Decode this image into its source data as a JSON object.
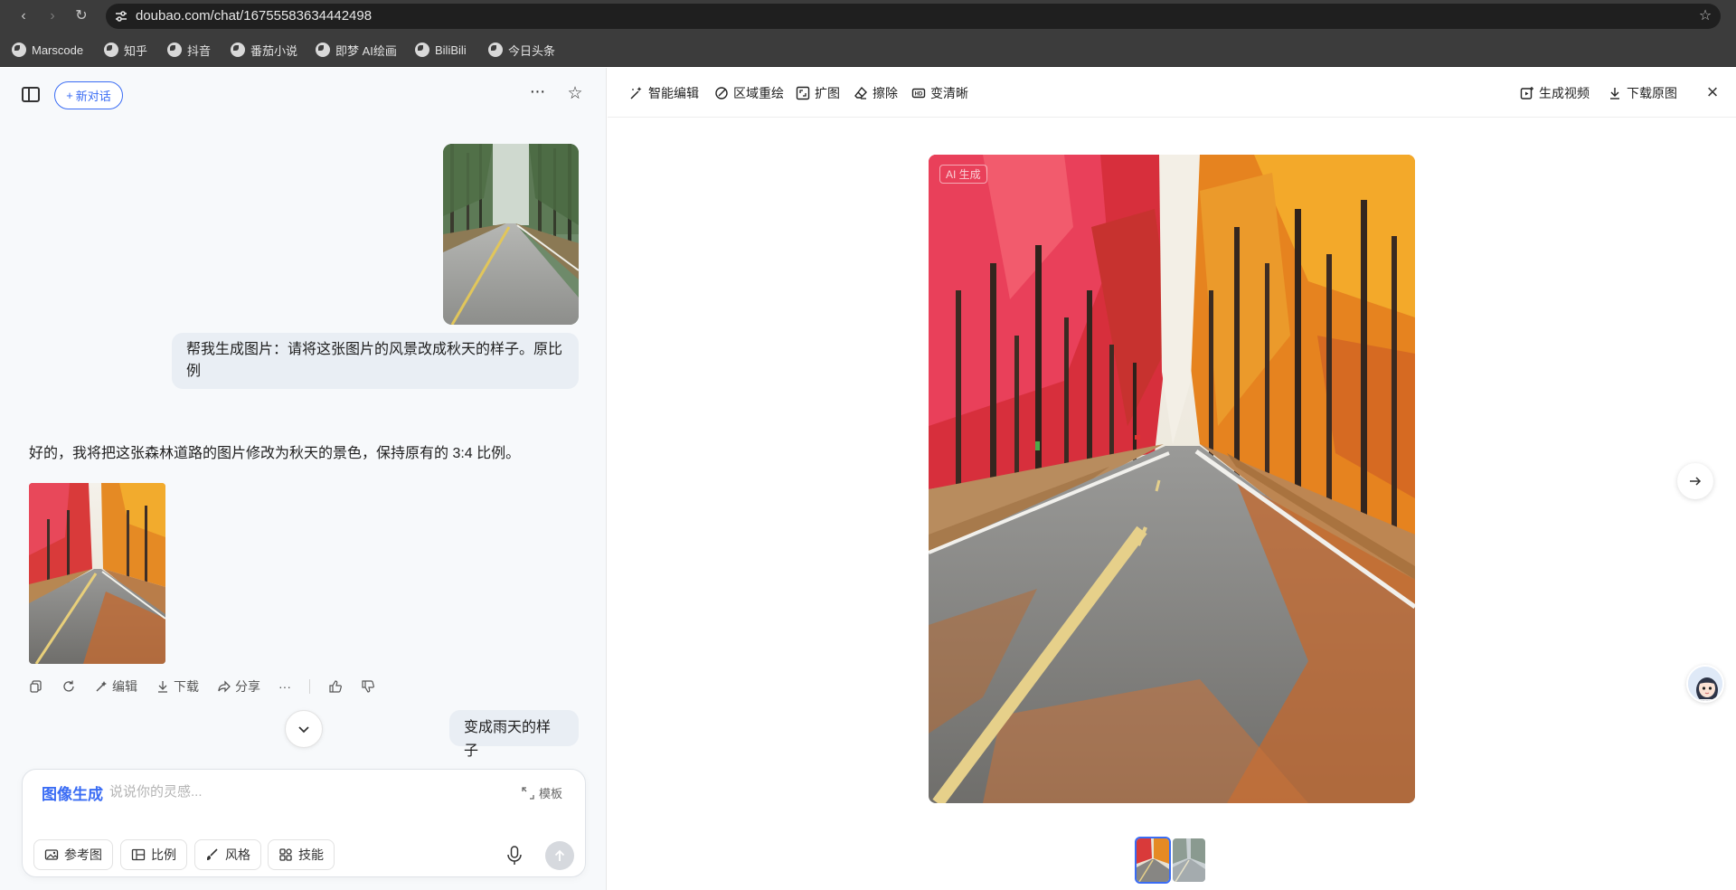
{
  "browser": {
    "url": "doubao.com/chat/16755583634442498",
    "bookmarks": [
      "Marscode",
      "知乎",
      "抖音",
      "番茄小说",
      "即梦 AI绘画",
      "BiliBili",
      "今日头条"
    ]
  },
  "chat": {
    "new_chat_label": "新对话",
    "messages": {
      "user_prompt_1": "帮我生成图片：请将这张图片的风景改成秋天的样子。原比例",
      "ai_reply_1": "好的，我将把这张森林道路的图片修改为秋天的景色，保持原有的 3:4 比例。",
      "user_prompt_2": "变成雨天的样子"
    },
    "actions": {
      "edit": "编辑",
      "download": "下载",
      "share": "分享",
      "more": "···"
    },
    "composer": {
      "mode": "图像生成",
      "placeholder": "说说你的灵感...",
      "template": "模板",
      "chips": [
        "参考图",
        "比例",
        "风格",
        "技能"
      ]
    }
  },
  "viewer": {
    "tools": [
      "智能编辑",
      "区域重绘",
      "扩图",
      "擦除",
      "变清晰"
    ],
    "generate_video": "生成视频",
    "download_original": "下载原图",
    "ai_badge": "AI 生成"
  }
}
